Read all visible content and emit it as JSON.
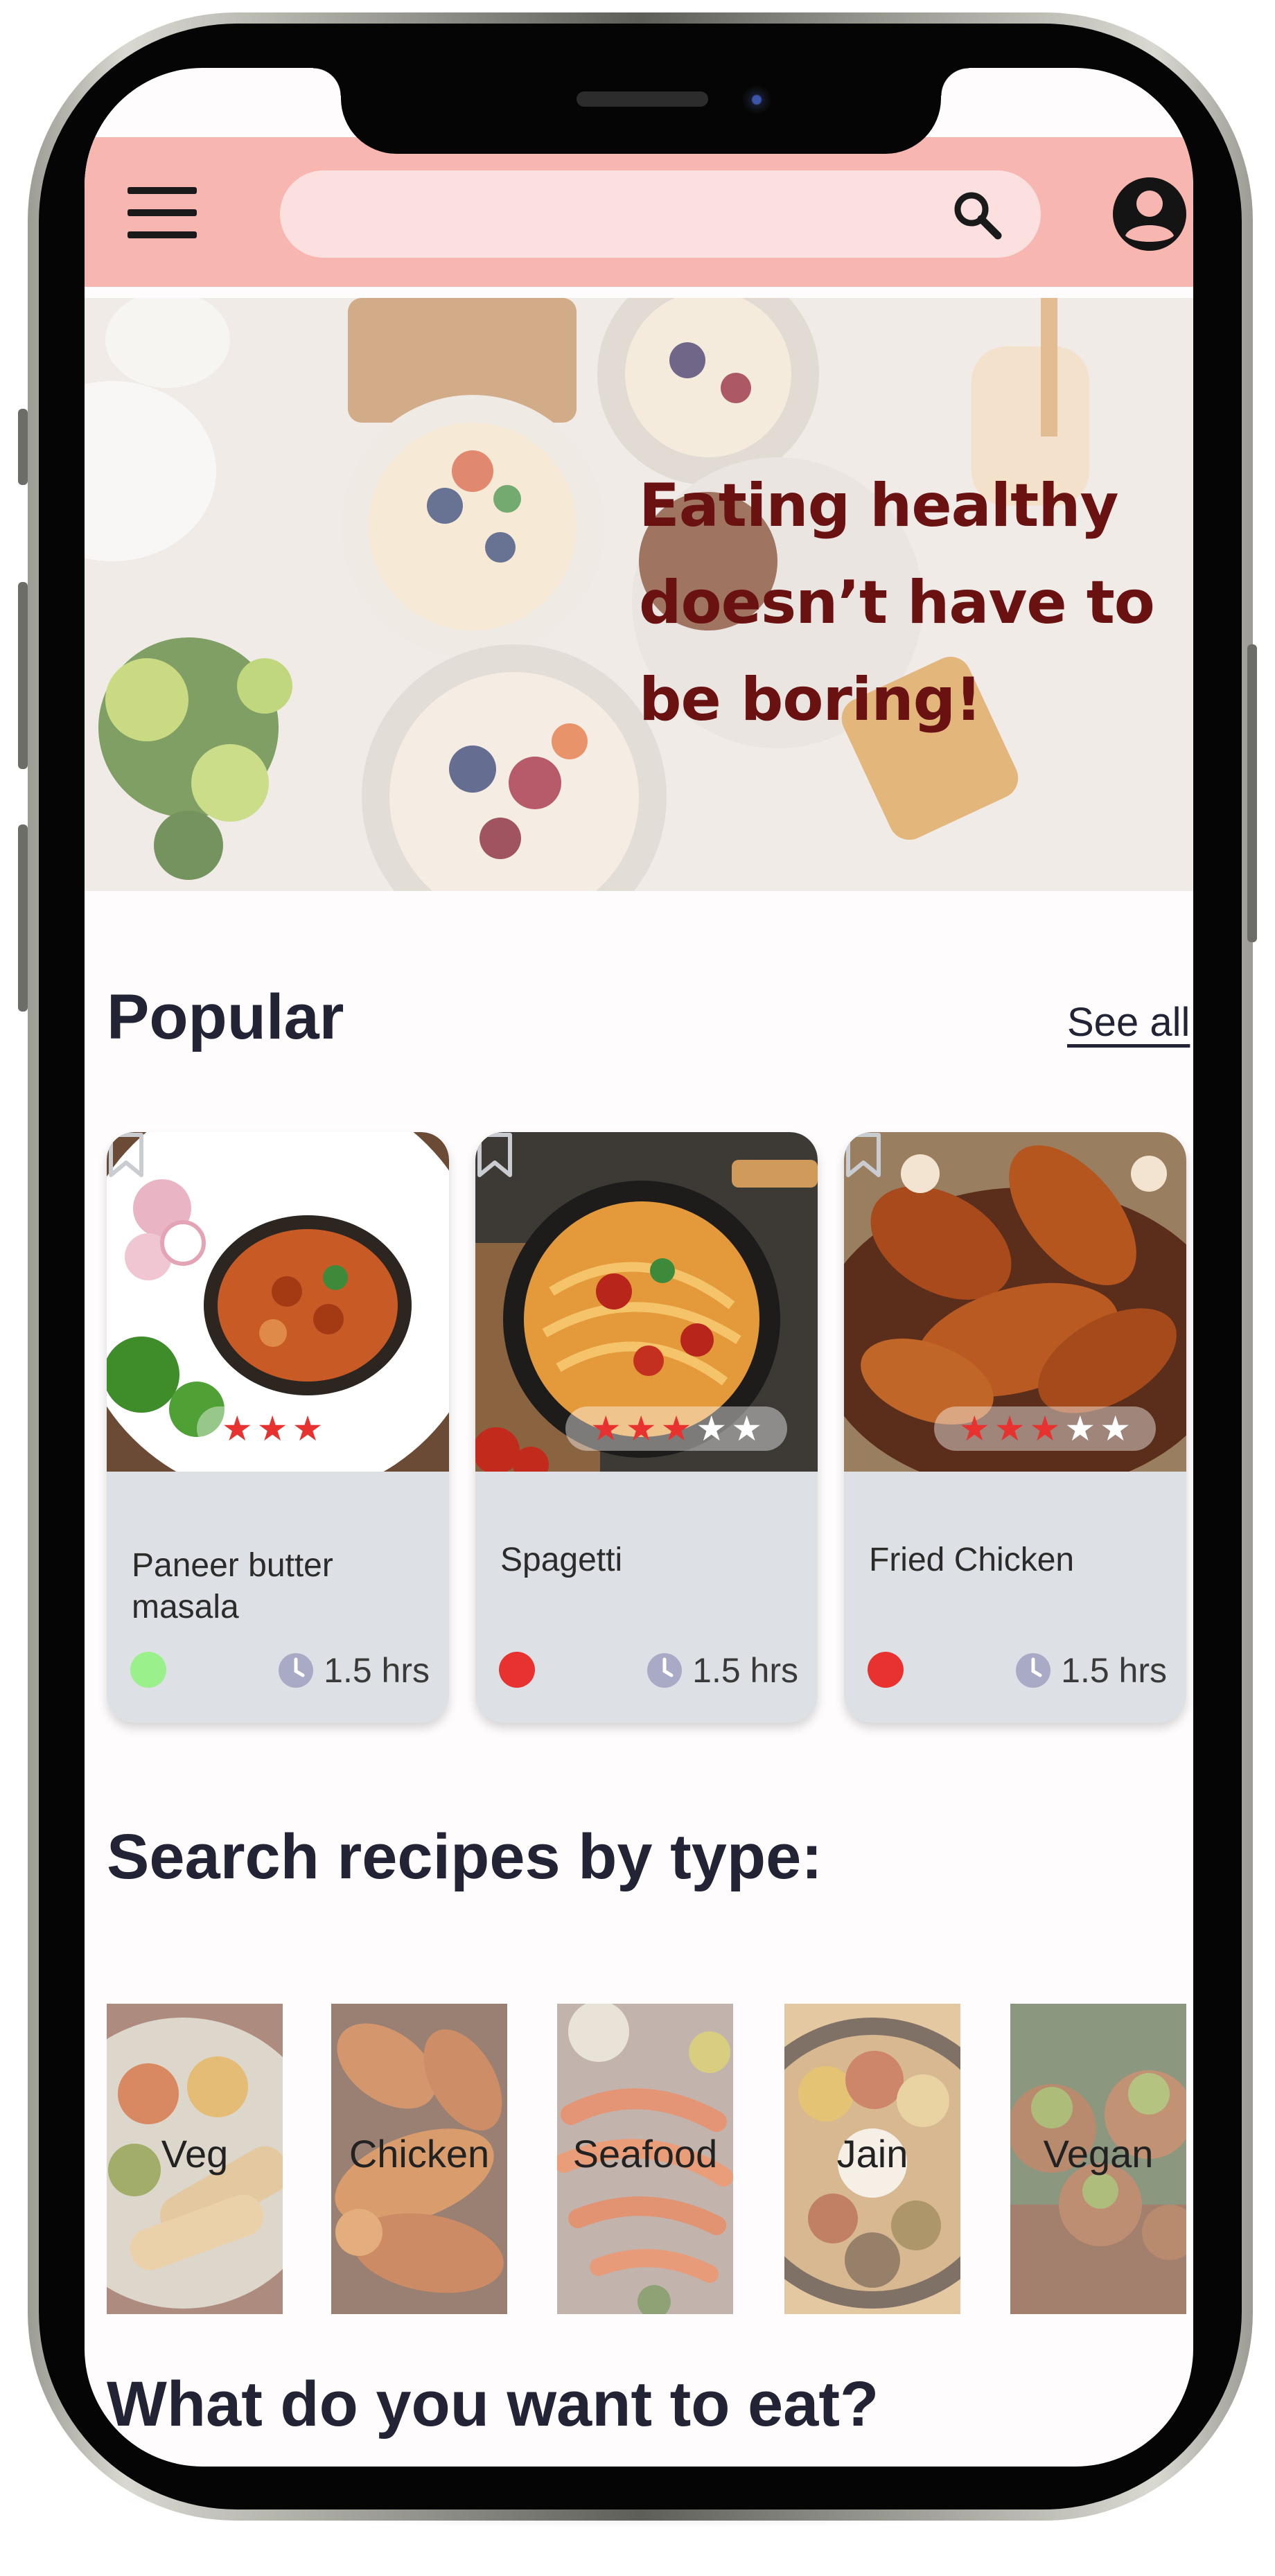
{
  "search": {
    "value": "",
    "placeholder": ""
  },
  "hero": {
    "lines": [
      "Eating healthy",
      "doesn’t have to",
      "be boring!"
    ]
  },
  "popular": {
    "title": "Popular",
    "see_all": "See all",
    "cards": [
      {
        "name": "Paneer butter masala",
        "time": "1.5 hrs",
        "rating": 3,
        "diet": "veg",
        "diet_color": "#9af08a"
      },
      {
        "name": "Spagetti",
        "time": "1.5 hrs",
        "rating": 3,
        "diet": "non-veg",
        "diet_color": "#e8322f"
      },
      {
        "name": "Fried Chicken",
        "time": "1.5 hrs",
        "rating": 3,
        "diet": "non-veg",
        "diet_color": "#e8322f"
      }
    ]
  },
  "types": {
    "title": "Search recipes by type:",
    "items": [
      {
        "label": "Veg"
      },
      {
        "label": "Chicken"
      },
      {
        "label": "Seafood"
      },
      {
        "label": "Jain"
      },
      {
        "label": "Vegan"
      }
    ]
  },
  "eat": {
    "title": "What do you want to eat?"
  },
  "colors": {
    "header": "#f8b6b1",
    "search_bg": "#fbe0df",
    "hero_text": "#6a1212",
    "card_bg": "#dde0e4",
    "star": "#e8322f",
    "title_text": "#232336"
  },
  "icons": [
    "menu-icon",
    "search-icon",
    "account-icon",
    "bookmark-icon",
    "star-icon",
    "clock-icon"
  ]
}
